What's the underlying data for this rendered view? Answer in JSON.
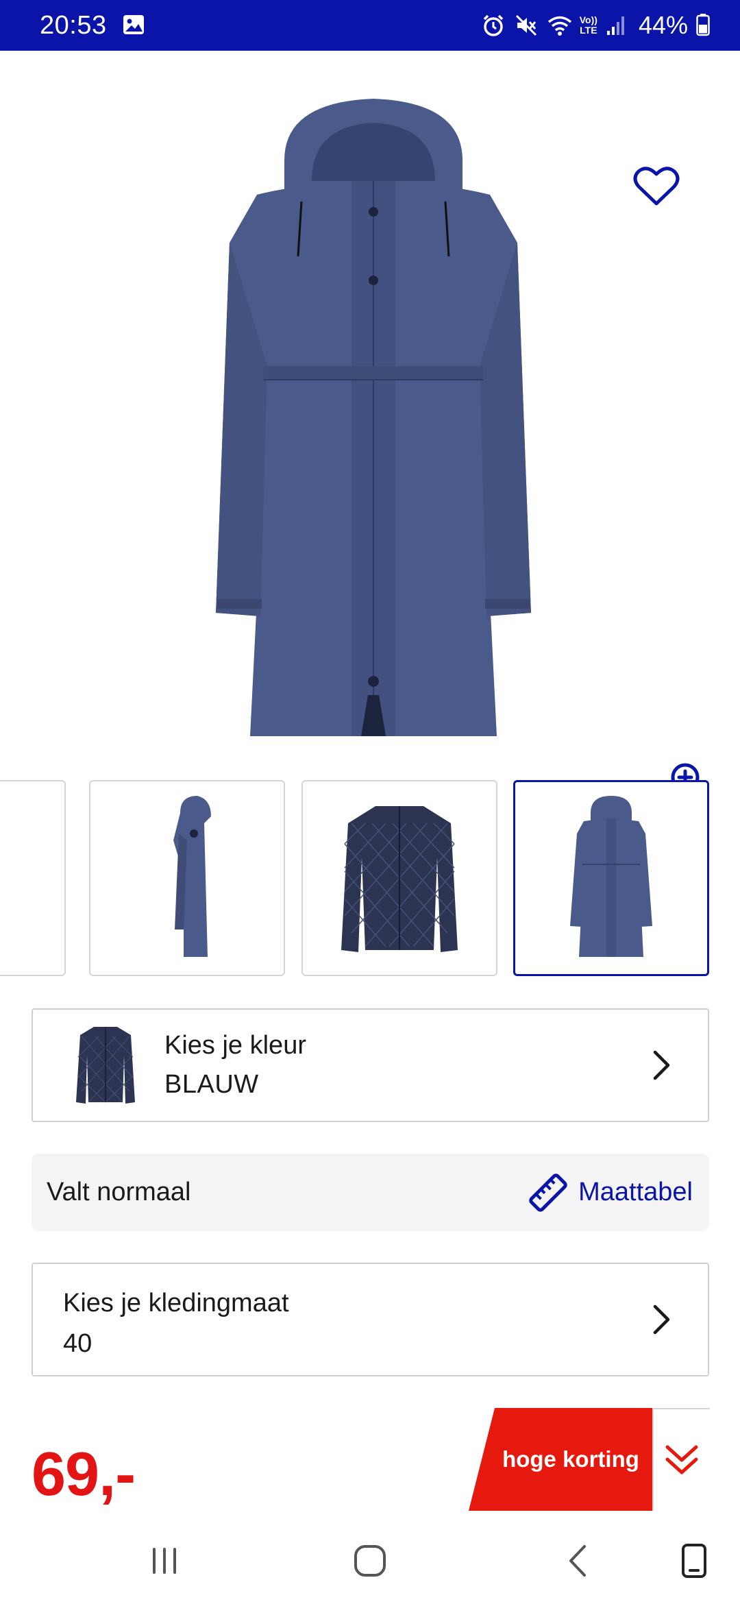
{
  "status_bar": {
    "time": "20:53",
    "battery_percent": "44%",
    "icons": [
      "gallery-icon",
      "alarm-icon",
      "mute-icon",
      "wifi-icon",
      "volte-icon",
      "signal-icon",
      "battery-icon"
    ],
    "volte_label_top": "Vo))",
    "volte_label_bottom": "LTE"
  },
  "product": {
    "image_icon": "coat-image",
    "favorite_icon": "heart-outline-icon",
    "zoom_icon": "zoom-in-icon"
  },
  "thumbnails": [
    {
      "name": "partial-thumbnail",
      "active": false
    },
    {
      "name": "coat-side-view",
      "active": false
    },
    {
      "name": "quilted-inner-jacket",
      "active": false
    },
    {
      "name": "coat-front-view",
      "active": true
    }
  ],
  "color_selector": {
    "label": "Kies je kleur",
    "value": "BLAUW"
  },
  "fit": {
    "text": "Valt normaal",
    "size_chart_label": "Maattabel",
    "size_chart_icon": "ruler-icon"
  },
  "size_selector": {
    "label": "Kies je kledingmaat",
    "value": "40"
  },
  "price": {
    "amount": "69,-",
    "promo_label": "hoge korting",
    "promo_icon": "double-chevron-down-icon"
  },
  "colors": {
    "brand_blue": "#0a14a8",
    "price_red": "#e31414",
    "coat_blue": "#4a5a8a"
  },
  "nav_bar": {
    "icons": [
      "recents-icon",
      "home-icon",
      "back-icon",
      "screen-icon"
    ]
  }
}
